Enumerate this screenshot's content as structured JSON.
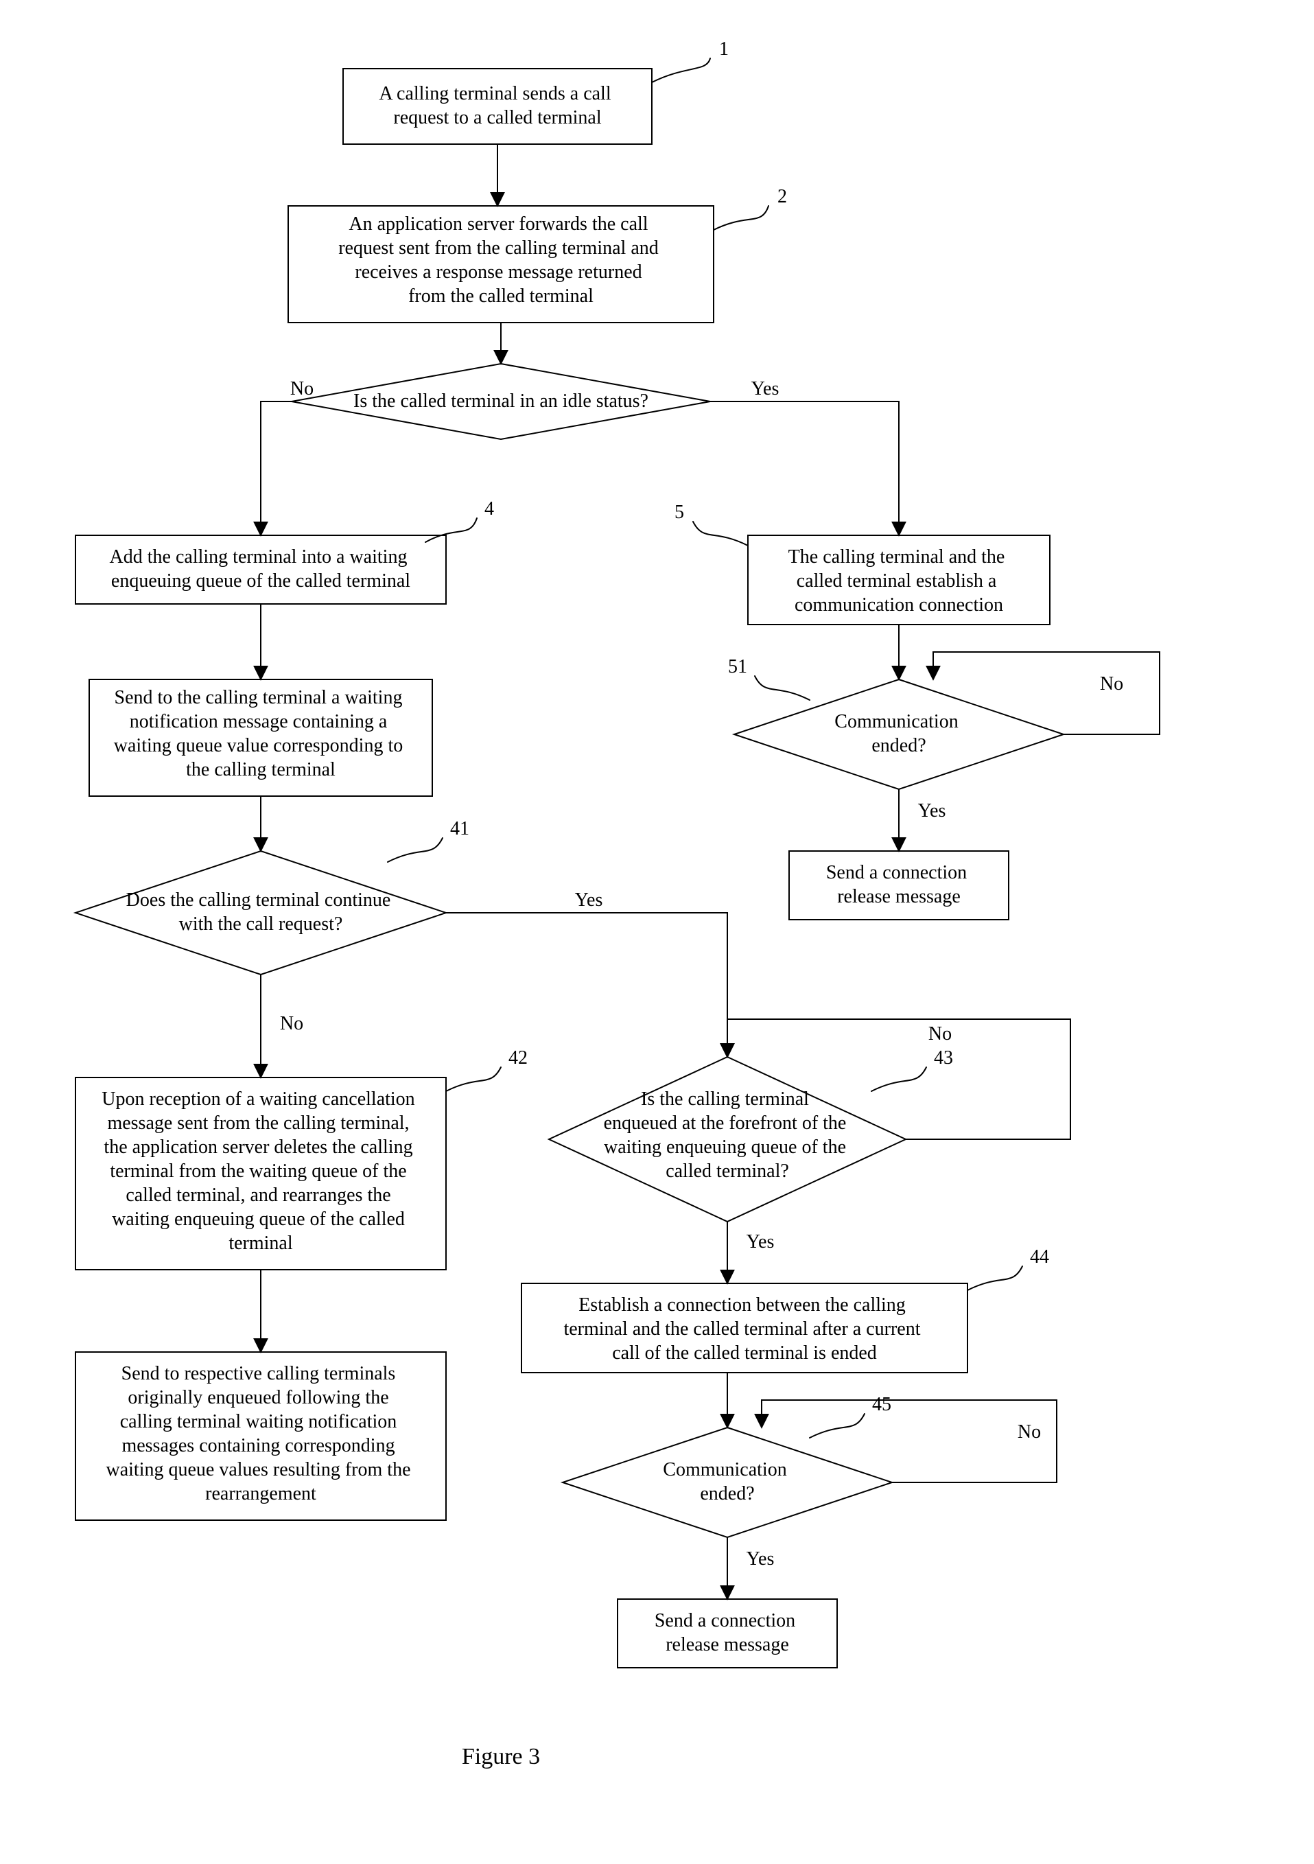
{
  "chart_data": {
    "type": "flowchart",
    "title": "Figure 3",
    "nodes": [
      {
        "id": 1,
        "num": "1",
        "shape": "box",
        "text": [
          "A calling terminal sends a call",
          "request to a called terminal"
        ]
      },
      {
        "id": 2,
        "num": "2",
        "shape": "box",
        "text": [
          "An application server forwards the call",
          "request sent from the calling terminal and",
          "receives a response message returned",
          "from the called terminal"
        ]
      },
      {
        "id": 3,
        "num": "",
        "shape": "diamond",
        "text": [
          "Is the called terminal in an idle status?"
        ]
      },
      {
        "id": 4,
        "num": "4",
        "shape": "box",
        "text": [
          "Add the calling terminal into a waiting",
          "enqueuing queue of the called terminal"
        ]
      },
      {
        "id": 40,
        "num": "",
        "shape": "box",
        "text": [
          "Send to the calling terminal a waiting",
          "notification message containing a",
          "waiting queue value corresponding to",
          "the calling terminal"
        ]
      },
      {
        "id": 41,
        "num": "41",
        "shape": "diamond",
        "text": [
          "Does the calling terminal continue",
          "with the call request?"
        ]
      },
      {
        "id": 42,
        "num": "42",
        "shape": "box",
        "text": [
          "Upon reception of a waiting cancellation",
          "message sent from the calling terminal,",
          "the application server deletes the calling",
          "terminal from the waiting queue of the",
          "called terminal, and rearranges the",
          "waiting enqueuing queue of the called",
          "terminal"
        ]
      },
      {
        "id": 421,
        "num": "",
        "shape": "box",
        "text": [
          "Send to respective calling terminals",
          "originally enqueued following the",
          "calling terminal waiting notification",
          "messages containing corresponding",
          "waiting queue values resulting from the",
          "rearrangement"
        ]
      },
      {
        "id": 43,
        "num": "43",
        "shape": "diamond",
        "text": [
          "Is the calling terminal",
          "enqueued at the forefront of the",
          "waiting enqueuing queue of the",
          "called terminal?"
        ]
      },
      {
        "id": 44,
        "num": "44",
        "shape": "box",
        "text": [
          "Establish a connection between the calling",
          "terminal and the called terminal after a current",
          "call of the called terminal is ended"
        ]
      },
      {
        "id": 45,
        "num": "45",
        "shape": "diamond",
        "text": [
          "Communication",
          "ended?"
        ]
      },
      {
        "id": 451,
        "num": "",
        "shape": "box",
        "text": [
          "Send a connection",
          "release message"
        ]
      },
      {
        "id": 5,
        "num": "5",
        "shape": "box",
        "text": [
          "The calling terminal and the",
          "called terminal establish a",
          "communication connection"
        ]
      },
      {
        "id": 51,
        "num": "51",
        "shape": "diamond",
        "text": [
          "Communication",
          "ended?"
        ]
      },
      {
        "id": 52,
        "num": "",
        "shape": "box",
        "text": [
          "Send a connection",
          "release message"
        ]
      }
    ],
    "edges": [
      {
        "from": 1,
        "to": 2
      },
      {
        "from": 2,
        "to": 3
      },
      {
        "from": 3,
        "to": 4,
        "label": "No"
      },
      {
        "from": 3,
        "to": 5,
        "label": "Yes"
      },
      {
        "from": 4,
        "to": 40
      },
      {
        "from": 40,
        "to": 41
      },
      {
        "from": 41,
        "to": 42,
        "label": "No"
      },
      {
        "from": 41,
        "to": 43,
        "label": "Yes"
      },
      {
        "from": 42,
        "to": 421
      },
      {
        "from": 43,
        "to": 44,
        "label": "Yes"
      },
      {
        "from": 43,
        "to": 43,
        "label": "No"
      },
      {
        "from": 44,
        "to": 45
      },
      {
        "from": 45,
        "to": 451,
        "label": "Yes"
      },
      {
        "from": 45,
        "to": 44,
        "label": "No"
      },
      {
        "from": 5,
        "to": 51
      },
      {
        "from": 51,
        "to": 52,
        "label": "Yes"
      },
      {
        "from": 51,
        "to": 51,
        "label": "No"
      }
    ]
  },
  "labels": {
    "yes": "Yes",
    "no": "No"
  },
  "caption": "Figure 3"
}
